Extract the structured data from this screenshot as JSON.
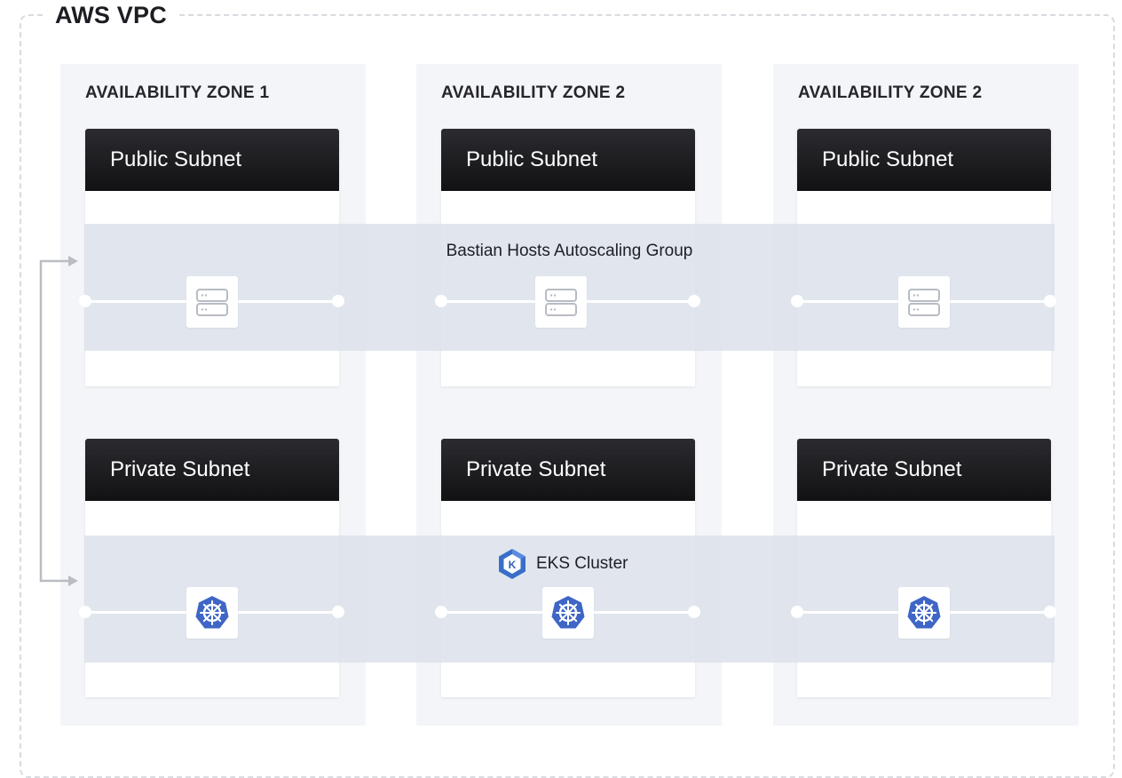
{
  "vpc": {
    "title": "AWS VPC"
  },
  "zones": [
    {
      "title": "AVAILABILITY ZONE 1",
      "public_subnet": "Public Subnet",
      "private_subnet": "Private Subnet"
    },
    {
      "title": "AVAILABILITY ZONE 2",
      "public_subnet": "Public Subnet",
      "private_subnet": "Private Subnet"
    },
    {
      "title": "AVAILABILITY ZONE 2",
      "public_subnet": "Public Subnet",
      "private_subnet": "Private Subnet"
    }
  ],
  "bastion_group": {
    "label": "Bastian Hosts Autoscaling Group",
    "node_icon": "server-icon"
  },
  "eks_cluster": {
    "label": "EKS Cluster",
    "logo_letter": "K",
    "node_icon": "kubernetes-icon"
  },
  "colors": {
    "subnet_header": "#1a1a1e",
    "zone_background": "#f3f5f9",
    "group_band": "#dae0ea",
    "kubernetes_blue": "#3f66c6",
    "eks_logo_blue": "#3a6fc8",
    "connector": "#b9bcc2"
  }
}
